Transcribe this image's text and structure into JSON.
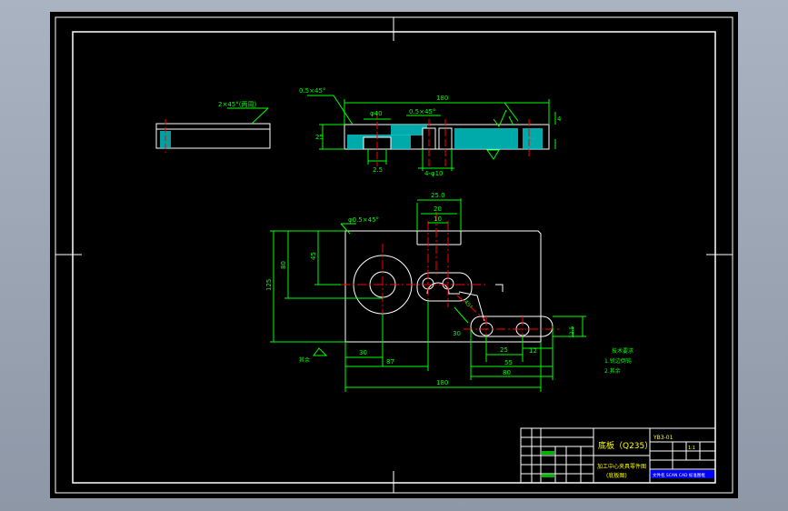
{
  "drawing": {
    "colors": {
      "background": "#000000",
      "frame": "#ffffff",
      "dimension": "#00ff00",
      "center": "#ff0000",
      "hatch": "#00c8c8",
      "part": "#ffffff",
      "label_text": "#ffff00",
      "stamp_fill": "#0000ff"
    },
    "section_view": {
      "chamfer_note": "2×45°(两周)",
      "overall_width": "180",
      "chamfer_top": "0.5×45°",
      "chamfer_mid": "0.5×45°",
      "bore": "φ40",
      "height": "25",
      "step_right": "4",
      "step_small": "2.5",
      "hole_note": "4-φ10"
    },
    "plan_view": {
      "chamfer_note": "φ0.5×45°",
      "top_dim_1": "25.0",
      "top_dim_2": "20",
      "top_dim_3": "10",
      "overall_height": "125",
      "inner_height": "80",
      "center_offset": "45",
      "left_offset": "30",
      "bore_pos": "87",
      "overall_width": "180",
      "slot_height": "30",
      "slot_offset": "25",
      "slot_width": "55",
      "slot_pitch": "12",
      "slot_total": "80",
      "slot_right": "12.5",
      "slot_angle": "45°",
      "surface_note": "其余"
    },
    "notes": {
      "title": "技术要求",
      "line1": "1.锐边倒钝",
      "line2": "2.其余"
    },
    "title_block": {
      "part_name": "底板（Q235）",
      "drawing_no": "YB3-01",
      "subtitle": "加工中心夹具零件图",
      "subtitle2": "(底板图)",
      "scale_label": "1:1",
      "stamp_text": "文件名 SCAN CAD 标准图框"
    }
  }
}
